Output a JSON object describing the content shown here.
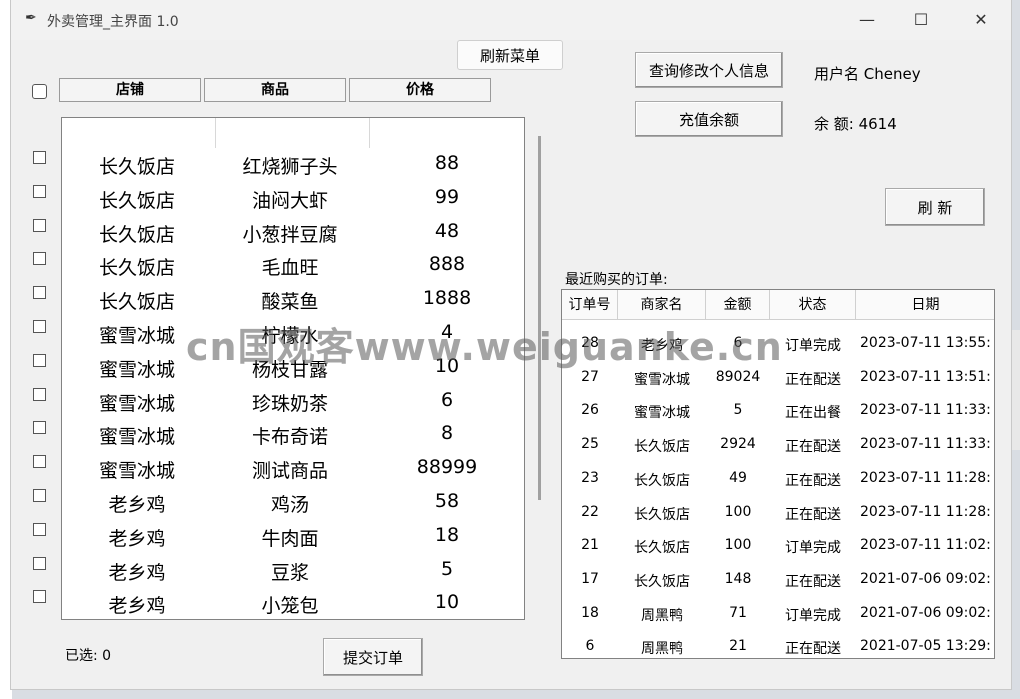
{
  "window": {
    "title": "外卖管理_主界面 1.0",
    "min_glyph": "—",
    "max_glyph": "☐",
    "close_glyph": "✕"
  },
  "toolbar": {
    "refresh_menu": "刷新菜单",
    "modify_info": "查询修改个人信息",
    "recharge": "充值余额",
    "refresh": "刷 新",
    "submit": "提交订单"
  },
  "user": {
    "username_label": "用户名 Cheney",
    "balance_label": "余  额: 4614"
  },
  "menu": {
    "headers": [
      "店铺",
      "商品",
      "价格"
    ],
    "rows": [
      {
        "shop": "长久饭店",
        "item": "红烧狮子头",
        "price": "88"
      },
      {
        "shop": "长久饭店",
        "item": "油闷大虾",
        "price": "99"
      },
      {
        "shop": "长久饭店",
        "item": "小葱拌豆腐",
        "price": "48"
      },
      {
        "shop": "长久饭店",
        "item": "毛血旺",
        "price": "888"
      },
      {
        "shop": "长久饭店",
        "item": "酸菜鱼",
        "price": "1888"
      },
      {
        "shop": "蜜雪冰城",
        "item": "柠檬水",
        "price": "4"
      },
      {
        "shop": "蜜雪冰城",
        "item": "杨枝甘露",
        "price": "10"
      },
      {
        "shop": "蜜雪冰城",
        "item": "珍珠奶茶",
        "price": "6"
      },
      {
        "shop": "蜜雪冰城",
        "item": "卡布奇诺",
        "price": "8"
      },
      {
        "shop": "蜜雪冰城",
        "item": "测试商品",
        "price": "88999"
      },
      {
        "shop": "老乡鸡",
        "item": "鸡汤",
        "price": "58"
      },
      {
        "shop": "老乡鸡",
        "item": "牛肉面",
        "price": "18"
      },
      {
        "shop": "老乡鸡",
        "item": "豆浆",
        "price": "5"
      },
      {
        "shop": "老乡鸡",
        "item": "小笼包",
        "price": "10"
      }
    ],
    "selected_label": "已选: 0"
  },
  "orders": {
    "title": "最近购买的订单:",
    "headers": [
      "订单号",
      "商家名",
      "金额",
      "状态",
      "日期"
    ],
    "rows": [
      {
        "id": "28",
        "shop": "老乡鸡",
        "amount": "6",
        "status": "订单完成",
        "date": "2023-07-11 13:55:"
      },
      {
        "id": "27",
        "shop": "蜜雪冰城",
        "amount": "89024",
        "status": "正在配送",
        "date": "2023-07-11 13:51:"
      },
      {
        "id": "26",
        "shop": "蜜雪冰城",
        "amount": "5",
        "status": "正在出餐",
        "date": "2023-07-11 11:33:"
      },
      {
        "id": "25",
        "shop": "长久饭店",
        "amount": "2924",
        "status": "正在配送",
        "date": "2023-07-11 11:33:"
      },
      {
        "id": "23",
        "shop": "长久饭店",
        "amount": "49",
        "status": "正在配送",
        "date": "2023-07-11 11:28:"
      },
      {
        "id": "22",
        "shop": "长久饭店",
        "amount": "100",
        "status": "正在配送",
        "date": "2023-07-11 11:28:"
      },
      {
        "id": "21",
        "shop": "长久饭店",
        "amount": "100",
        "status": "订单完成",
        "date": "2023-07-11 11:02:"
      },
      {
        "id": "17",
        "shop": "长久饭店",
        "amount": "148",
        "status": "正在配送",
        "date": "2021-07-06 09:02:"
      },
      {
        "id": "18",
        "shop": "周黑鸭",
        "amount": "71",
        "status": "订单完成",
        "date": "2021-07-06 09:02:"
      },
      {
        "id": "6",
        "shop": "周黑鸭",
        "amount": "21",
        "status": "正在配送",
        "date": "2021-07-05 13:29:"
      }
    ]
  },
  "watermark": "cn国观客www.weiguanke.cn"
}
